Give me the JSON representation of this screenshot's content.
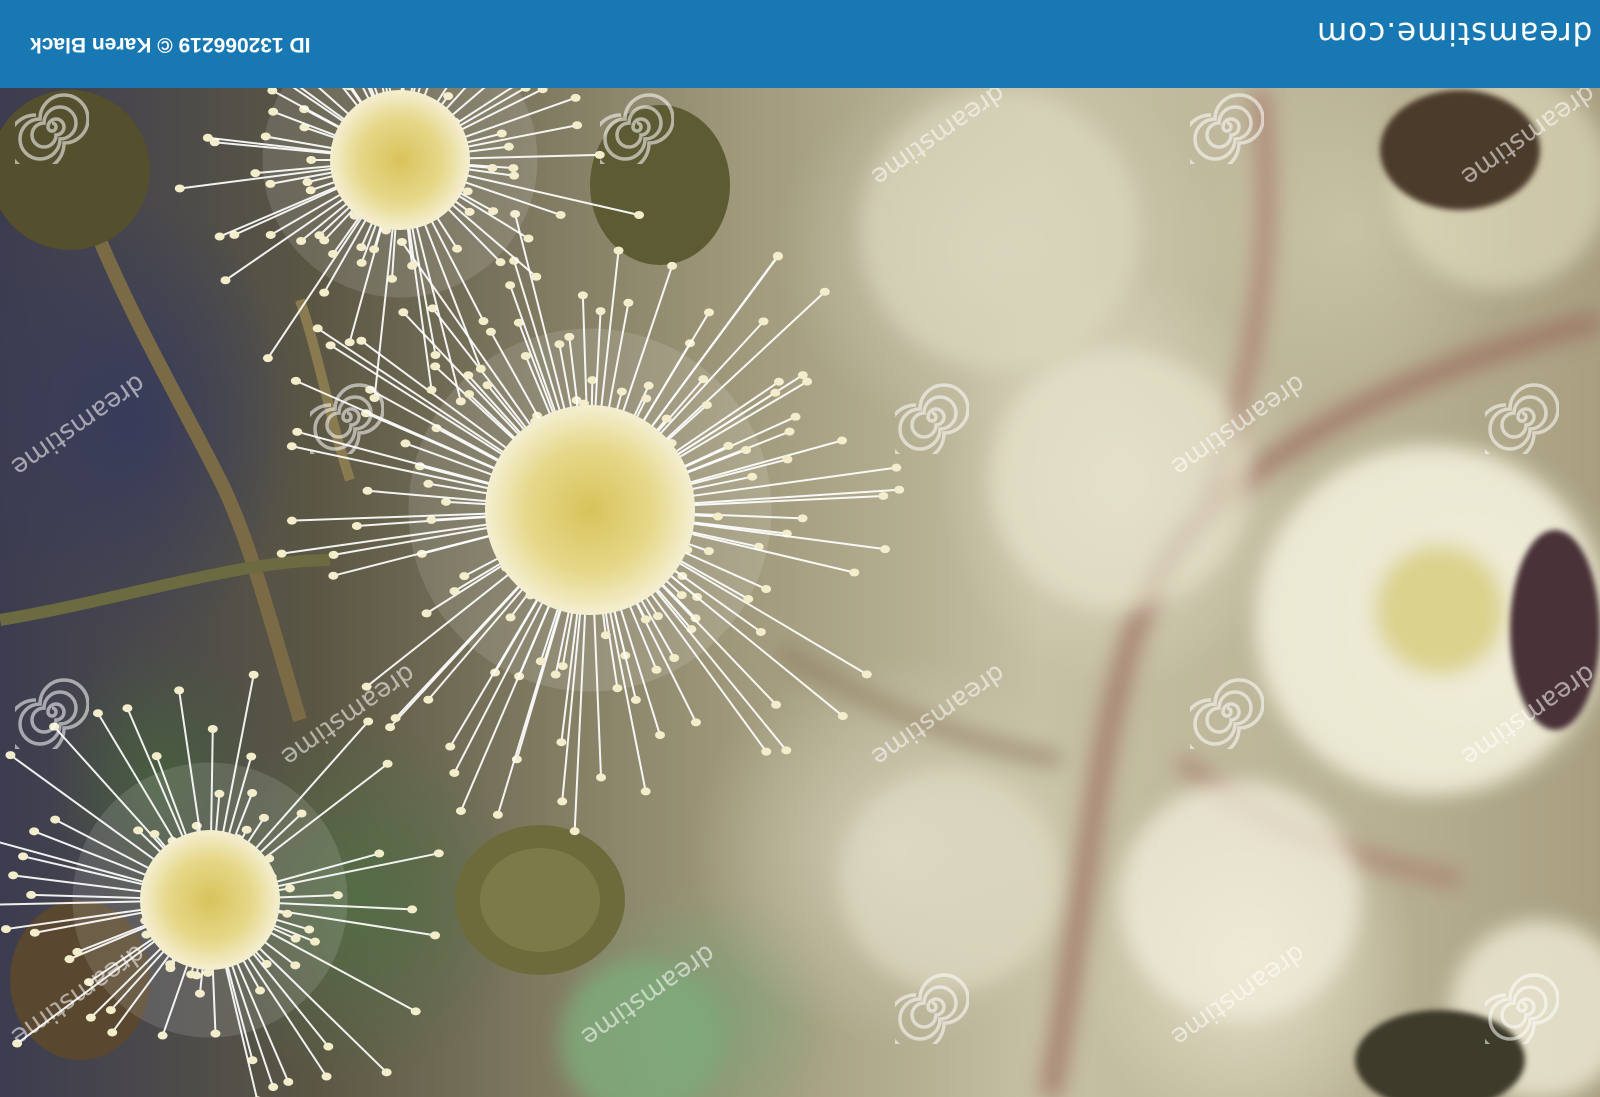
{
  "top_bar": {
    "brand": "dreamstime.com",
    "photo_id_credit": "ID 132066219 © Karen Black",
    "color": "#1778b4"
  },
  "watermark": {
    "text": "dreamstime",
    "icon": "spiral-icon"
  },
  "photo": {
    "subject_colors": {
      "petal": "#ffffff",
      "center": "#e1cf6a",
      "stamen_tip": "#f3edcc",
      "bud": "#5c5a2e",
      "stem": "#8b6d4c"
    }
  }
}
